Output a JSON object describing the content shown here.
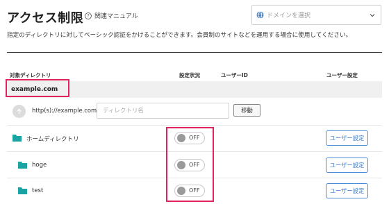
{
  "header": {
    "title": "アクセス制限",
    "help_label": "関連マニュアル",
    "help_icon": "question-circle-icon",
    "domain_select": {
      "placeholder": "ドメインを選択",
      "icon": "globe-icon"
    }
  },
  "description": "指定のディレクトリに対してベーシック認証をかけることができます。会員制のサイトなどを運用する場合に使用してください。",
  "table": {
    "columns": [
      "対象ディレクトリ",
      "設定状況",
      "ユーザーID",
      "ユーザー設定"
    ],
    "domain": "example.com",
    "move_row": {
      "url_prefix": "http(s)://example.com/",
      "input_placeholder": "ディレクトリ名",
      "input_value": "",
      "move_button": "移動"
    },
    "rows": [
      {
        "name": "ホームディレクトリ",
        "status": "OFF",
        "user_id": "",
        "button": "ユーザー設定"
      },
      {
        "name": "hoge",
        "status": "OFF",
        "user_id": "",
        "button": "ユーザー設定"
      },
      {
        "name": "test",
        "status": "OFF",
        "user_id": "",
        "button": "ユーザー設定"
      }
    ]
  },
  "colors": {
    "folder": "#1aa3a3",
    "highlight": "#e0245e",
    "button_accent": "#3a78c2"
  }
}
